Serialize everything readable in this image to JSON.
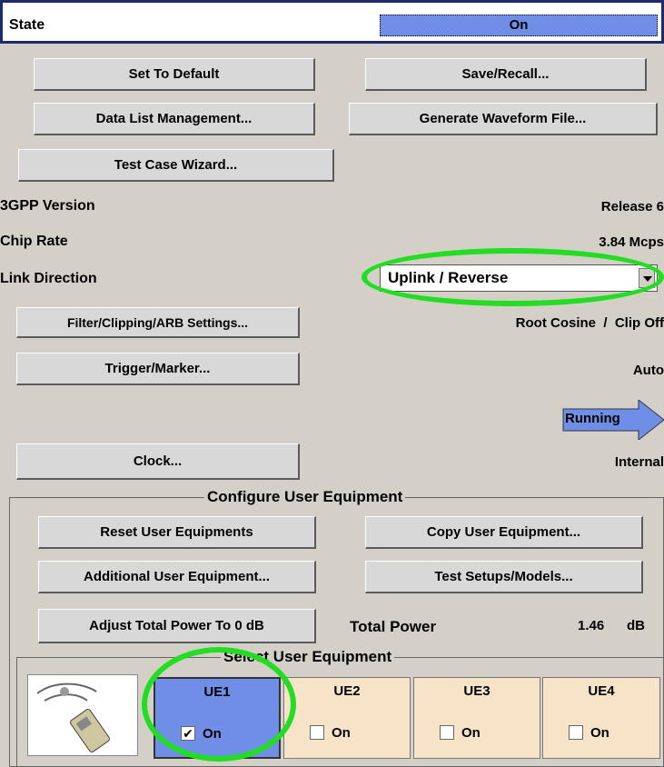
{
  "state": {
    "label": "State",
    "value": "On"
  },
  "buttons": {
    "set_default": "Set To Default",
    "save_recall": "Save/Recall...",
    "data_list": "Data List Management...",
    "gen_waveform": "Generate Waveform File...",
    "test_case": "Test Case Wizard...",
    "filter": "Filter/Clipping/ARB Settings...",
    "trigger": "Trigger/Marker...",
    "clock": "Clock..."
  },
  "params": {
    "version_label": "3GPP Version",
    "version_value": "Release 6",
    "chip_label": "Chip Rate",
    "chip_value": "3.84 Mcps",
    "link_label": "Link Direction",
    "link_value": "Uplink / Reverse",
    "filter_value": "Root Cosine  /  Clip Off",
    "trigger_value": "Auto",
    "running": "Running",
    "clock_value": "Internal"
  },
  "configure": {
    "title": "Configure User Equipment",
    "reset": "Reset User Equipments",
    "copy": "Copy User Equipment...",
    "additional": "Additional User Equipment...",
    "setups": "Test Setups/Models...",
    "adjust": "Adjust Total Power To 0 dB",
    "total_label": "Total Power",
    "total_value": "1.46",
    "total_unit": "dB"
  },
  "select": {
    "title": "Select User Equipment",
    "ue": [
      {
        "name": "UE1",
        "on_label": "On",
        "checked": "✔"
      },
      {
        "name": "UE2",
        "on_label": "On",
        "checked": ""
      },
      {
        "name": "UE3",
        "on_label": "On",
        "checked": ""
      },
      {
        "name": "UE4",
        "on_label": "On",
        "checked": ""
      }
    ]
  },
  "colors": {
    "active_blue": "#6f8fe6",
    "ue_inactive": "#f6e3c8",
    "highlight_green": "#22dd22"
  }
}
